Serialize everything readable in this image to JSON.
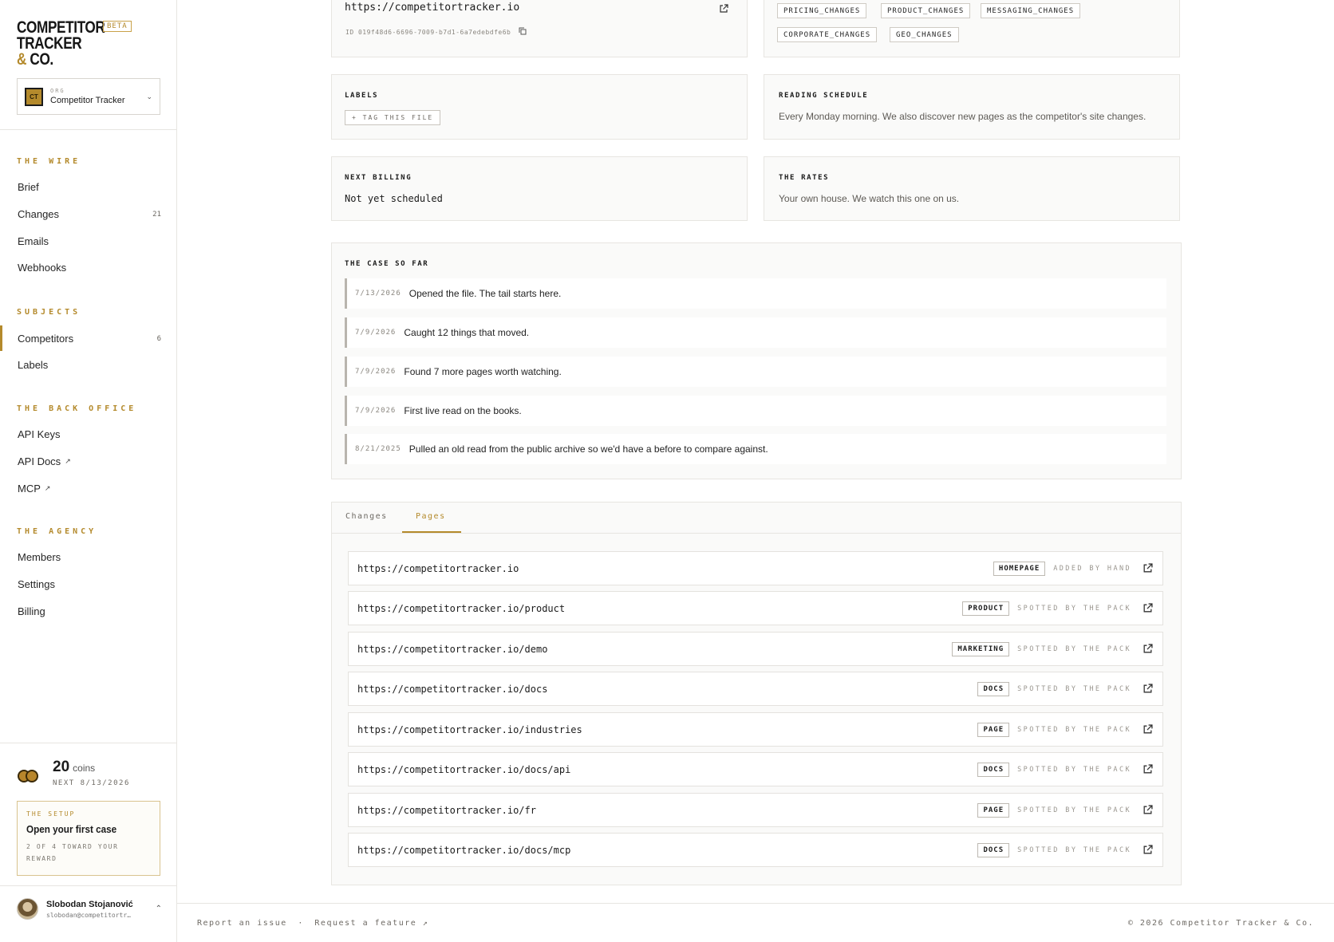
{
  "brand": {
    "line1": "COMPETITOR",
    "line2": "TRACKER",
    "amp": "&",
    "line3": "CO.",
    "badge": "BETA"
  },
  "org": {
    "badge": "CT",
    "kicker": "ORG",
    "name": "Competitor Tracker"
  },
  "nav": {
    "wire": {
      "title": "THE WIRE",
      "items": [
        {
          "label": "Brief",
          "count": ""
        },
        {
          "label": "Changes",
          "count": "21"
        },
        {
          "label": "Emails",
          "count": ""
        },
        {
          "label": "Webhooks",
          "count": ""
        }
      ]
    },
    "subjects": {
      "title": "SUBJECTS",
      "items": [
        {
          "label": "Competitors",
          "count": "6"
        },
        {
          "label": "Labels",
          "count": ""
        }
      ]
    },
    "back_office": {
      "title": "THE BACK OFFICE",
      "items": [
        {
          "label": "API Keys",
          "ext": ""
        },
        {
          "label": "API Docs",
          "ext": "↗"
        },
        {
          "label": "MCP",
          "ext": "↗"
        }
      ]
    },
    "agency": {
      "title": "THE AGENCY",
      "items": [
        {
          "label": "Members"
        },
        {
          "label": "Settings"
        },
        {
          "label": "Billing"
        }
      ]
    }
  },
  "coins": {
    "value": "20",
    "unit": "coins",
    "next": "NEXT 8/13/2026"
  },
  "setup": {
    "kicker": "THE SETUP",
    "title": "Open your first case",
    "sub": "2 OF 4 TOWARD YOUR REWARD"
  },
  "user": {
    "name": "Slobodan Stojanović",
    "email": "slobodan@competitortr…"
  },
  "site": {
    "url": "https://competitortracker.io",
    "id": "ID 019f48d6-6696-7009-b7d1-6a7edebdfe6b"
  },
  "watch_chips": [
    "PRICING_CHANGES",
    "PRODUCT_CHANGES",
    "MESSAGING_CHANGES",
    "CORPORATE_CHANGES",
    "GEO_CHANGES"
  ],
  "labels": {
    "title": "LABELS",
    "button": "+ TAG THIS FILE"
  },
  "reading": {
    "title": "READING SCHEDULE",
    "text": "Every Monday morning. We also discover new pages as the competitor's site changes."
  },
  "billing": {
    "title": "NEXT BILLING",
    "value": "Not yet scheduled"
  },
  "rates": {
    "title": "THE RATES",
    "text": "Your own house. We watch this one on us."
  },
  "case": {
    "title": "THE CASE SO FAR",
    "events": [
      {
        "date": "7/13/2026",
        "text": "Opened the file. The tail starts here."
      },
      {
        "date": "7/9/2026",
        "text": "Caught 12 things that moved."
      },
      {
        "date": "7/9/2026",
        "text": "Found 7 more pages worth watching."
      },
      {
        "date": "7/9/2026",
        "text": "First live read on the books."
      },
      {
        "date": "8/21/2025",
        "text": "Pulled an old read from the public archive so we'd have a before to compare against."
      }
    ]
  },
  "tabs": [
    {
      "label": "Changes",
      "active": false
    },
    {
      "label": "Pages",
      "active": true
    }
  ],
  "pages": [
    {
      "url": "https://competitortracker.io",
      "type": "HOMEPAGE",
      "source": "ADDED BY HAND"
    },
    {
      "url": "https://competitortracker.io/product",
      "type": "PRODUCT",
      "source": "SPOTTED BY THE PACK"
    },
    {
      "url": "https://competitortracker.io/demo",
      "type": "MARKETING",
      "source": "SPOTTED BY THE PACK"
    },
    {
      "url": "https://competitortracker.io/docs",
      "type": "DOCS",
      "source": "SPOTTED BY THE PACK"
    },
    {
      "url": "https://competitortracker.io/industries",
      "type": "PAGE",
      "source": "SPOTTED BY THE PACK"
    },
    {
      "url": "https://competitortracker.io/docs/api",
      "type": "DOCS",
      "source": "SPOTTED BY THE PACK"
    },
    {
      "url": "https://competitortracker.io/fr",
      "type": "PAGE",
      "source": "SPOTTED BY THE PACK"
    },
    {
      "url": "https://competitortracker.io/docs/mcp",
      "type": "DOCS",
      "source": "SPOTTED BY THE PACK"
    }
  ],
  "footer": {
    "report": "Report an issue",
    "sep": "·",
    "request": "Request a feature ↗",
    "copyright": "© 2026 Competitor Tracker & Co."
  },
  "colors": {
    "accent": "#b48a2c",
    "border": "#e7e5e1",
    "panel": "#fafaf9"
  }
}
